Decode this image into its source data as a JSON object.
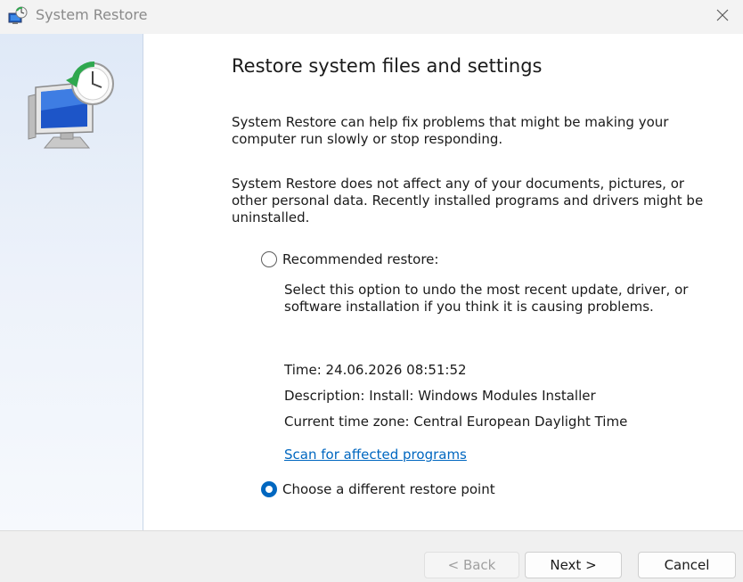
{
  "window": {
    "title": "System Restore",
    "title_icon": "system-restore-icon",
    "close_icon": "close-icon"
  },
  "sidebar": {
    "hero_icon": "monitor-restore-clock-icon"
  },
  "main": {
    "heading": "Restore system files and settings",
    "paragraph1": "System Restore can help fix problems that might be making your computer run slowly or stop responding.",
    "paragraph2": "System Restore does not affect any of your documents, pictures, or other personal data. Recently installed programs and drivers might be uninstalled.",
    "recommended": {
      "label": "Recommended restore:",
      "selected": false,
      "description": "Select this option to undo the most recent update, driver, or software installation if you think it is causing problems.",
      "time": "Time: 24.06.2026 08:51:52",
      "description_line": "Description: Install: Windows Modules Installer",
      "timezone": "Current time zone: Central European Daylight Time",
      "scan_link": "Scan for affected programs"
    },
    "different": {
      "label": "Choose a different restore point",
      "selected": true
    }
  },
  "footer": {
    "back_label": "< Back",
    "back_enabled": false,
    "next_label": "Next >",
    "cancel_label": "Cancel"
  },
  "colors": {
    "accent": "#0067c0",
    "link": "#0067c0",
    "sidebar_top": "#dfe9f7",
    "footer_bg": "#f0f0f0",
    "title_bar": "#f3f3f3"
  }
}
